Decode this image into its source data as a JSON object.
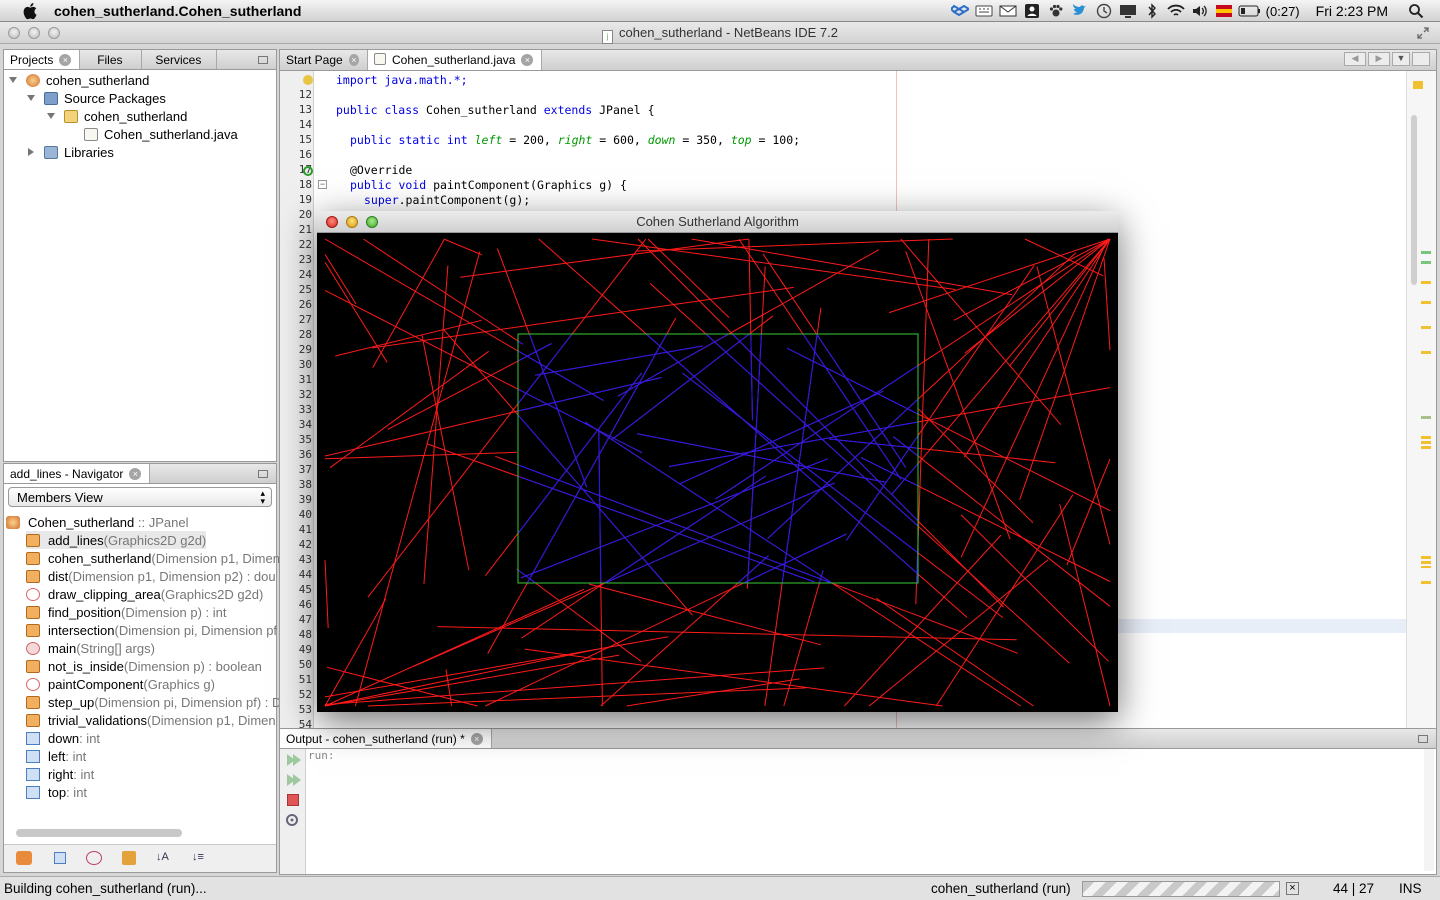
{
  "menubar": {
    "app_title": "cohen_sutherland.Cohen_sutherland",
    "battery": "(0:27)",
    "clock": "Fri 2:23 PM"
  },
  "window": {
    "title": "cohen_sutherland - NetBeans IDE 7.2"
  },
  "projects_panel": {
    "tabs": [
      "Projects",
      "Files",
      "Services"
    ],
    "tree": {
      "project": "cohen_sutherland",
      "source_packages": "Source Packages",
      "package": "cohen_sutherland",
      "file": "Cohen_sutherland.java",
      "libraries": "Libraries"
    }
  },
  "navigator": {
    "tab": "add_lines - Navigator",
    "view_select": "Members View",
    "class_name": "Cohen_sutherland",
    "class_type": ":: JPanel",
    "members": [
      {
        "name": "add_lines",
        "sig": "(Graphics2D g2d)",
        "kind": "method"
      },
      {
        "name": "cohen_sutherland",
        "sig": "(Dimension p1, Dimen",
        "kind": "method"
      },
      {
        "name": "dist",
        "sig": "(Dimension p1, Dimension p2) : dou",
        "kind": "method"
      },
      {
        "name": "draw_clipping_area",
        "sig": "(Graphics2D g2d)",
        "kind": "method-private"
      },
      {
        "name": "find_position",
        "sig": "(Dimension p) : int",
        "kind": "method"
      },
      {
        "name": "intersection",
        "sig": "(Dimension pi, Dimension pf",
        "kind": "method"
      },
      {
        "name": "main",
        "sig": "(String[] args)",
        "kind": "method-static"
      },
      {
        "name": "not_is_inside",
        "sig": "(Dimension p) : boolean",
        "kind": "method"
      },
      {
        "name": "paintComponent",
        "sig": "(Graphics g)",
        "kind": "method-private"
      },
      {
        "name": "step_up",
        "sig": "(Dimension pi, Dimension pf) : D",
        "kind": "method"
      },
      {
        "name": "trivial_validations",
        "sig": "(Dimension p1, Dimen",
        "kind": "method"
      },
      {
        "name": "down",
        "sig": " : int",
        "kind": "field"
      },
      {
        "name": "left",
        "sig": " : int",
        "kind": "field"
      },
      {
        "name": "right",
        "sig": " : int",
        "kind": "field"
      },
      {
        "name": "top",
        "sig": " : int",
        "kind": "field"
      }
    ]
  },
  "editor": {
    "tabs": [
      "Start Page",
      "Cohen_sutherland.java"
    ],
    "line_numbers": [
      "",
      "12",
      "13",
      "14",
      "15",
      "16",
      "17",
      "18",
      "19",
      "20",
      "21",
      "22",
      "23",
      "24",
      "25",
      "26",
      "27",
      "28",
      "29",
      "30",
      "31",
      "32",
      "33",
      "34",
      "35",
      "36",
      "37",
      "38",
      "39",
      "40",
      "41",
      "42",
      "43",
      "44",
      "45",
      "46",
      "47",
      "48",
      "49",
      "50",
      "51",
      "52",
      "53",
      "54"
    ],
    "code": {
      "l11": "import java.math.*;",
      "l13_a": "public class ",
      "l13_b": "Cohen_sutherland ",
      "l13_c": "extends ",
      "l13_d": "JPanel {",
      "l15_a": "public static int ",
      "l15_left": "left",
      "l15_b": " = 200, ",
      "l15_right": "right",
      "l15_c": " = 600, ",
      "l15_down": "down",
      "l15_d": " = 350, ",
      "l15_top": "top",
      "l15_e": " = 100;",
      "l17": "@Override",
      "l18_a": "public void ",
      "l18_b": "paintComponent(Graphics g) {",
      "l19_a": "super",
      "l19_b": ".paintComponent(g);"
    }
  },
  "app_window": {
    "title": "Cohen Sutherland Algorithm",
    "colors": {
      "background": "#000000",
      "outside_line": "#ff1a1a",
      "inside_line": "#1a1aff",
      "clip_rect": "#33cc33"
    }
  },
  "output": {
    "tab": "Output - cohen_sutherland (run) *",
    "text": "run:"
  },
  "status": {
    "left": "Building cohen_sutherland (run)...",
    "task": "cohen_sutherland (run)",
    "position": "44 | 27",
    "mode": "INS"
  }
}
